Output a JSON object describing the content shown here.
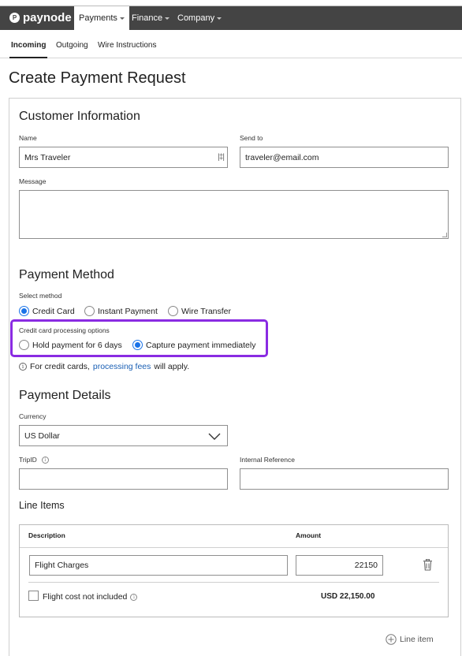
{
  "brand": {
    "name": "paynode",
    "mark": "P"
  },
  "nav": [
    {
      "label": "Payments"
    },
    {
      "label": "Finance"
    },
    {
      "label": "Company"
    }
  ],
  "subnav": [
    {
      "label": "Incoming"
    },
    {
      "label": "Outgoing"
    },
    {
      "label": "Wire Instructions"
    }
  ],
  "page": {
    "title": "Create Payment Request"
  },
  "customer": {
    "heading": "Customer Information",
    "name_label": "Name",
    "name_value": "Mrs Traveler",
    "sendto_label": "Send to",
    "sendto_value": "traveler@email.com",
    "message_label": "Message",
    "message_value": ""
  },
  "method": {
    "heading": "Payment Method",
    "select_label": "Select method",
    "options": [
      {
        "label": "Credit Card",
        "selected": true
      },
      {
        "label": "Instant Payment",
        "selected": false
      },
      {
        "label": "Wire Transfer",
        "selected": false
      }
    ],
    "cc_label": "Credit card processing options",
    "cc_options": [
      {
        "label": "Hold payment for 6 days",
        "selected": false
      },
      {
        "label": "Capture payment immediately",
        "selected": true
      }
    ],
    "note_prefix": "For credit cards,",
    "note_link": "processing fees",
    "note_suffix": "will apply."
  },
  "details": {
    "heading": "Payment Details",
    "currency_label": "Currency",
    "currency_value": "US Dollar",
    "tripid_label": "TripID",
    "tripid_value": "",
    "ref_label": "Internal Reference",
    "ref_value": ""
  },
  "line_items": {
    "heading": "Line Items",
    "col_description": "Description",
    "col_amount": "Amount",
    "rows": [
      {
        "description": "Flight Charges",
        "amount": "22150"
      }
    ],
    "flight_cost_label": "Flight cost not included",
    "total": "USD 22,150.00",
    "add_label": "Line item"
  },
  "colors": {
    "accent": "#1a73e8",
    "highlight": "#8a2be2",
    "topbar": "#444444",
    "link": "#1a5fb4"
  }
}
